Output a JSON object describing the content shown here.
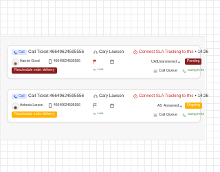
{
  "tickets": [
    {
      "type_label": "Call",
      "ticket_title": "Call Ticket:46649624595556",
      "agent_name": "Cary Lawson",
      "sla_text": "Connect SLA Tracking to this",
      "time": "14:26",
      "customer_name": "Harriet Good",
      "phone": "46649624595556",
      "ext": "UAS",
      "call_status": "Unanswered",
      "badge": "Pending",
      "action": "Reschedule order delivery",
      "live": "Live",
      "queue": "Call Queue",
      "direction": "Going Free"
    },
    {
      "type_label": "Call",
      "ticket_title": "Call Ticket:46649624595556",
      "agent_name": "Cary Lawson",
      "sla_text": "Connect SLA Tracking to this",
      "time": "14:26",
      "customer_name": "Antonia Larson",
      "phone": "46649624595556",
      "ext": "AS",
      "call_status": "Answered",
      "badge": "Ongoing",
      "action": "Reschedule order delivery",
      "live": "Live",
      "queue": "Call Queue",
      "direction": "Going Free"
    }
  ],
  "colors": {
    "accent_blue": "#3b5bdb",
    "sla_red": "#c62828",
    "pending_badge": "#8b1d1d",
    "ongoing_badge": "#ffb300",
    "live_green": "#2e7d32"
  },
  "icons": {
    "type": "phone-icon",
    "agent": "headset-icon",
    "sla": "clock-alert-icon",
    "phone": "mobile-phone-icon",
    "flag": "flag-icon",
    "calendar": "calendar-icon",
    "status": "chevron-down-icon",
    "live": "live-signal-icon",
    "queue": "queue-icon",
    "direction": "phone-outgoing-icon"
  }
}
